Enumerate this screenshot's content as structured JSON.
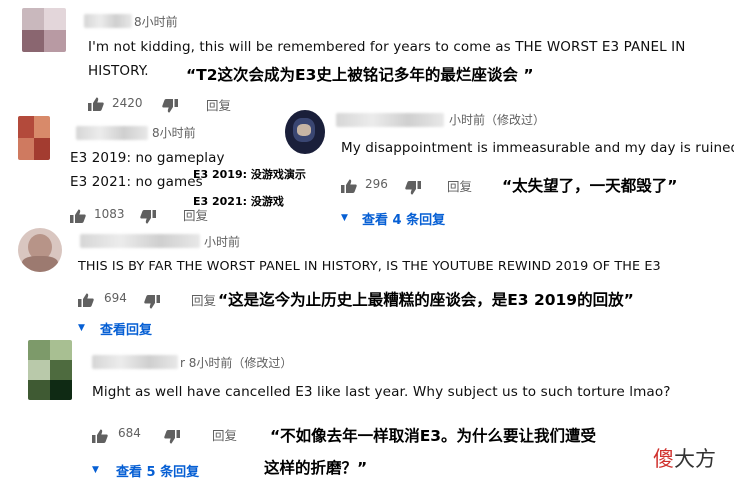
{
  "comments": [
    {
      "time": "8小时前",
      "text_line1": "I'm not kidding, this will be remembered for years to come as THE WORST E3 PANEL IN",
      "text_line2": "HISTORY.",
      "likes": "2420",
      "reply_label": "回复",
      "annotation": "“T2这次会成为E3史上被铭记多年的最烂座谈会  ”"
    },
    {
      "time": "8小时前",
      "text_line1": "E3 2019: no gameplay",
      "text_line2": "E3 2021: no games",
      "likes": "1083",
      "reply_label": "回复",
      "annotation_line1": "E3 2019: 没游戏演示",
      "annotation_line2": "E3 2021: 没游戏"
    },
    {
      "time": "小时前（修改过）",
      "text": "My disappointment is immeasurable and my day is ruined",
      "likes": "296",
      "reply_label": "回复",
      "annotation": "“太失望了，一天都毁了”",
      "view_replies": "查看 4 条回复"
    },
    {
      "time": "小时前",
      "text": "THIS IS BY FAR THE WORST PANEL IN HISTORY, IS THE YOUTUBE REWIND 2019 OF THE E3",
      "likes": "694",
      "reply_label": "回复",
      "annotation": "“这是迄今为止历史上最糟糕的座谈会，是E3 2019的回放”",
      "view_replies": "查看回复"
    },
    {
      "time": "r 8小时前（修改过）",
      "text": "Might as well have cancelled E3 like last year. Why subject us to such torture lmao?",
      "likes": "684",
      "reply_label": "回复",
      "annotation_line1": "“不如像去年一样取消E3。为什么要让我们遭受",
      "annotation_line2": "这样的折磨？”",
      "view_replies": "查看 5 条回复"
    }
  ],
  "watermark": {
    "part1": "傻",
    "part2": "大方"
  },
  "colors": {
    "link": "#065fd4",
    "meta": "#606060",
    "watermark_red": "#d0312d"
  },
  "icons": [
    "thumb-up-icon",
    "thumb-down-icon",
    "caret-down-icon"
  ]
}
